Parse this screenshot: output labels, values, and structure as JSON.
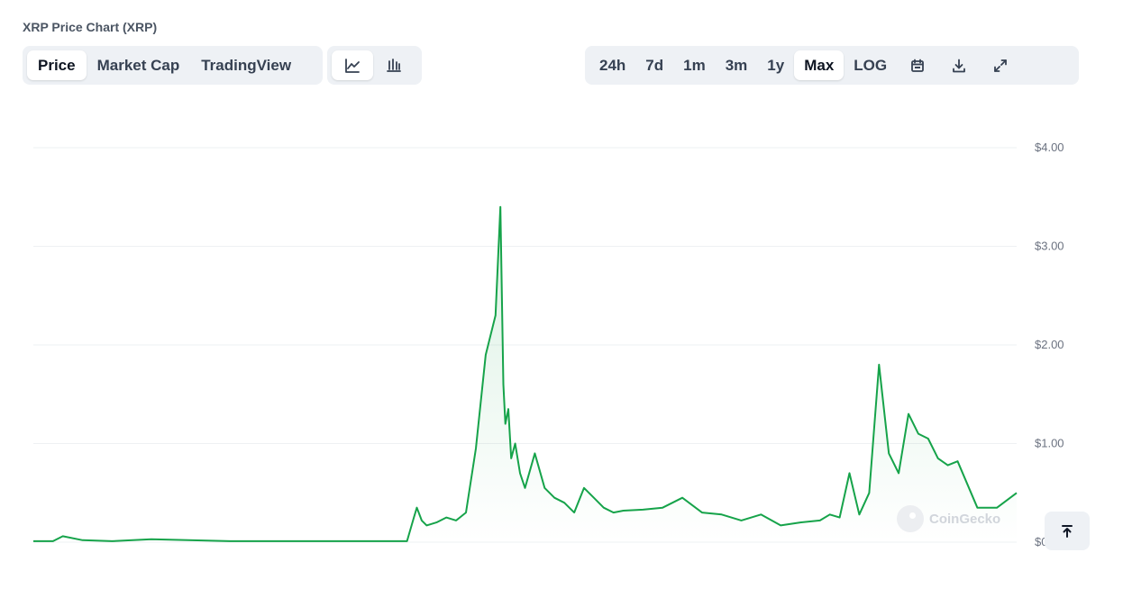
{
  "title": "XRP Price Chart (XRP)",
  "tabs": [
    "Price",
    "Market Cap",
    "TradingView"
  ],
  "active_tab": "Price",
  "chart_types": [
    "line-chart-icon",
    "candlestick-icon"
  ],
  "active_chart_type": "line-chart-icon",
  "ranges": [
    "24h",
    "7d",
    "1m",
    "3m",
    "1y",
    "Max",
    "LOG"
  ],
  "active_range": "Max",
  "tool_icons": [
    "calendar-icon",
    "download-icon",
    "expand-icon"
  ],
  "watermark": "CoinGecko",
  "scroll_top_icon": "arrow-up-to-line-icon",
  "colors": {
    "line": "#16a34a",
    "area_top": "#16a34a",
    "grid": "#eef0f3",
    "axis_text": "#6b7280"
  },
  "chart_data": {
    "type": "area",
    "series": [
      {
        "x": [
          0,
          2,
          3,
          5,
          8,
          12,
          20,
          34,
          38,
          38.7,
          39,
          39.5,
          40,
          41,
          42,
          43,
          44,
          45,
          46,
          47,
          47.5,
          47.8,
          48,
          48.3,
          48.6,
          49,
          49.5,
          50,
          51,
          52,
          53,
          54,
          55,
          56,
          57,
          58,
          59,
          60,
          62,
          64,
          66,
          68,
          70,
          72,
          74,
          76,
          78,
          80,
          81,
          82,
          83,
          84,
          85,
          86,
          87,
          88,
          89,
          90,
          91,
          92,
          93,
          94,
          96,
          98,
          100
        ],
        "y": [
          0.01,
          0.01,
          0.06,
          0.02,
          0.01,
          0.03,
          0.01,
          0.01,
          0.01,
          0.25,
          0.35,
          0.22,
          0.17,
          0.2,
          0.25,
          0.22,
          0.3,
          0.95,
          1.9,
          2.3,
          3.4,
          1.6,
          1.2,
          1.35,
          0.85,
          1.0,
          0.7,
          0.55,
          0.9,
          0.55,
          0.45,
          0.4,
          0.3,
          0.55,
          0.45,
          0.35,
          0.3,
          0.32,
          0.33,
          0.35,
          0.45,
          0.3,
          0.28,
          0.22,
          0.28,
          0.17,
          0.2,
          0.22,
          0.28,
          0.25,
          0.7,
          0.28,
          0.5,
          1.8,
          0.9,
          0.7,
          1.3,
          1.1,
          1.05,
          0.85,
          0.78,
          0.82,
          0.35,
          0.35,
          0.5
        ],
        "values_note": ""
      }
    ],
    "x_label": "",
    "ylabel": "",
    "yticks": [
      "$4.00",
      "$3.00",
      "$2.00",
      "$1.00",
      "$0"
    ],
    "ytick_values": [
      4,
      3,
      2,
      1,
      0
    ],
    "ylim": [
      0,
      4
    ],
    "grid": true,
    "scale": "linear"
  }
}
